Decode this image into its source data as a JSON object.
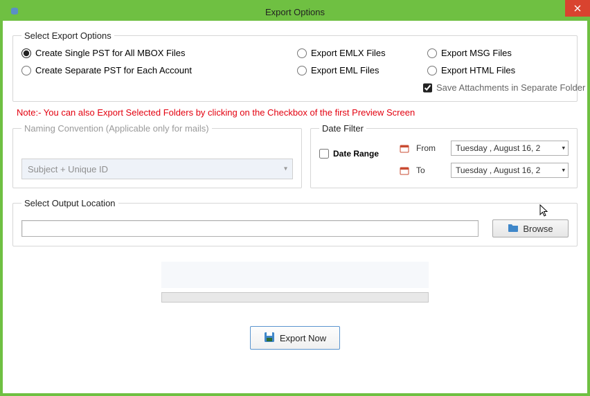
{
  "window": {
    "title": "Export Options",
    "close": "Close"
  },
  "exportOptions": {
    "legend": "Select Export Options",
    "opt_single_pst": "Create Single PST for All MBOX Files",
    "opt_separate_pst": "Create Separate PST for Each Account",
    "opt_emlx": "Export EMLX Files",
    "opt_eml": "Export EML Files",
    "opt_msg": "Export MSG Files",
    "opt_html": "Export HTML Files",
    "save_attachments": "Save Attachments in Separate Folder"
  },
  "note": "Note:- You can also Export Selected Folders by clicking on the Checkbox of the first Preview Screen",
  "naming": {
    "legend": "Naming Convention (Applicable only for mails)",
    "selected": "Subject + Unique ID"
  },
  "dateFilter": {
    "legend": "Date Filter",
    "date_range_label": "Date Range",
    "from_label": "From",
    "to_label": "To",
    "from_value": "Tuesday ,    August    16, 2",
    "to_value": "Tuesday ,    August    16, 2"
  },
  "output": {
    "legend": "Select Output Location",
    "path": "",
    "browse": "Browse"
  },
  "actions": {
    "export_now": "Export Now"
  }
}
